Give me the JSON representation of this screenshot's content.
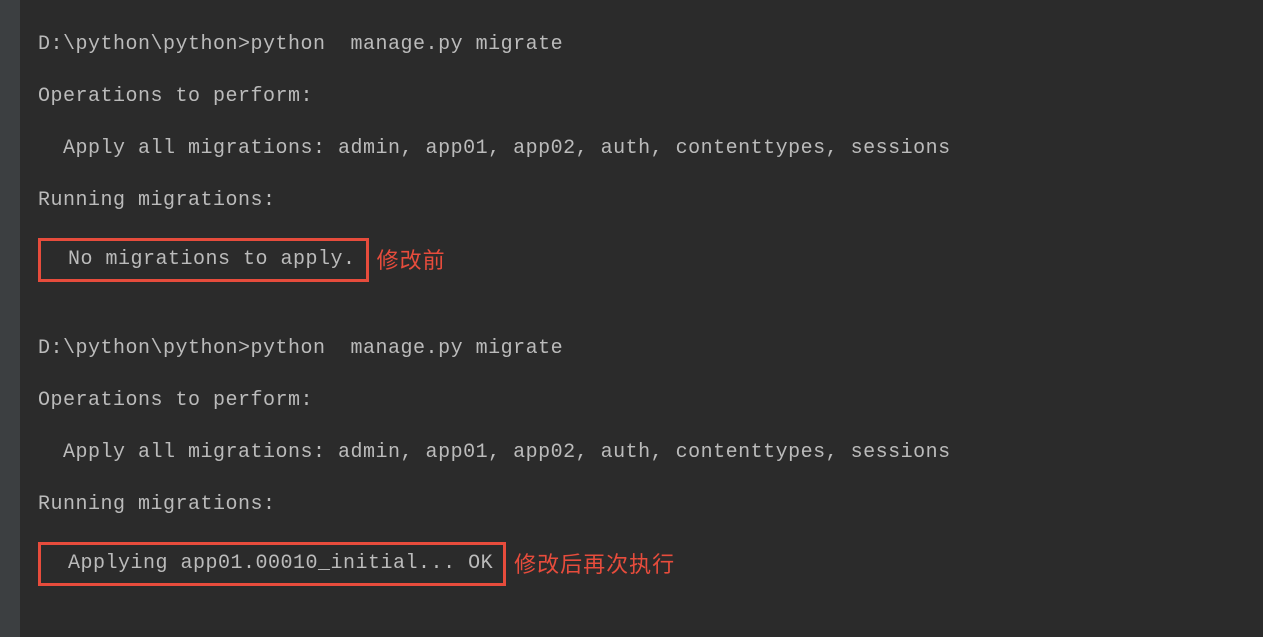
{
  "terminal": {
    "block1": {
      "prompt_command": "D:\\python\\python>python  manage.py migrate",
      "operations_header": "Operations to perform:",
      "apply_all": "  Apply all migrations: admin, app01, app02, auth, contenttypes, sessions",
      "running_header": "Running migrations:",
      "result_boxed": "  No migrations to apply.",
      "annotation": "修改前"
    },
    "block2": {
      "prompt_command": "D:\\python\\python>python  manage.py migrate",
      "operations_header": "Operations to perform:",
      "apply_all": "  Apply all migrations: admin, app01, app02, auth, contenttypes, sessions",
      "running_header": "Running migrations:",
      "result_boxed": "  Applying app01.00010_initial... OK",
      "annotation": "修改后再次执行"
    }
  }
}
